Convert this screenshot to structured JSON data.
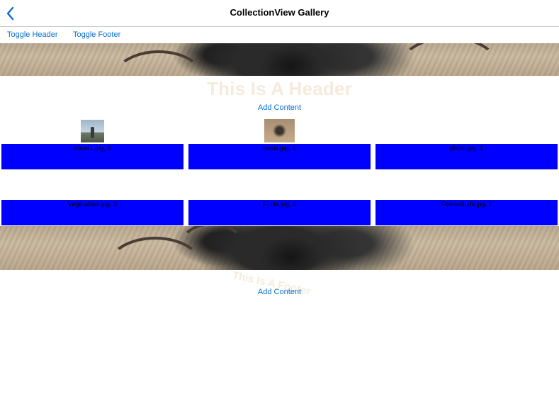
{
  "nav": {
    "title": "CollectionView Gallery",
    "back_icon": "chevron-left-icon"
  },
  "toolbar": {
    "toggle_header": "Toggle Header",
    "toggle_footer": "Toggle Footer"
  },
  "header": {
    "title": "This Is A Header",
    "add_content": "Add Content"
  },
  "items": [
    {
      "label": "cover1.jpg, 0"
    },
    {
      "label": "oasis.jpg, 1"
    },
    {
      "label": "photo.jpg, 2"
    },
    {
      "label": "Vegetables.jpg, 3"
    },
    {
      "label": "Fruits.jpg, 4"
    },
    {
      "label": "FlowerBuds.jpg, 5"
    }
  ],
  "footer": {
    "title": "This Is A Footer",
    "add_content": "Add Content"
  },
  "colors": {
    "accent": "#0a6ed1",
    "cell_background": "#0000ff",
    "overlay_text": "#f6eadc"
  }
}
